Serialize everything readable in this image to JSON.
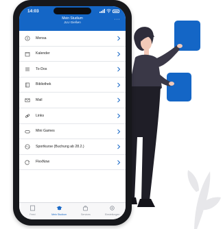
{
  "status_bar": {
    "time": "14:03"
  },
  "header": {
    "title": "Mein Studium",
    "subtitle": "JLU Gießen",
    "more_icon": "ellipsis-icon"
  },
  "menu": {
    "items": [
      {
        "label": "Mensa",
        "icon": "cutlery-icon"
      },
      {
        "label": "Kalender",
        "icon": "calendar-icon"
      },
      {
        "label": "To-Dos",
        "icon": "checklist-icon"
      },
      {
        "label": "Bibliothek",
        "icon": "book-icon"
      },
      {
        "label": "Mail",
        "icon": "mail-icon"
      },
      {
        "label": "Links",
        "icon": "link-icon"
      },
      {
        "label": "Mini Games",
        "icon": "gamepad-icon"
      },
      {
        "label": "Sportkurse (Buchung ab 28.2.)",
        "icon": "ball-icon"
      },
      {
        "label": "FlexNow",
        "icon": "refresh-icon"
      }
    ]
  },
  "tabbar": {
    "tabs": [
      {
        "label": "Feed",
        "icon": "feed-icon",
        "active": false
      },
      {
        "label": "Mein Studium",
        "icon": "graduation-cap-icon",
        "active": true
      },
      {
        "label": "Services",
        "icon": "bag-icon",
        "active": false
      },
      {
        "label": "Einstellungen",
        "icon": "gear-icon",
        "active": false
      }
    ]
  },
  "colors": {
    "accent": "#1466c6",
    "illustration_blue": "#1466c6",
    "figure_dark": "#2e2c3a",
    "leaf": "#e6e6e8"
  }
}
